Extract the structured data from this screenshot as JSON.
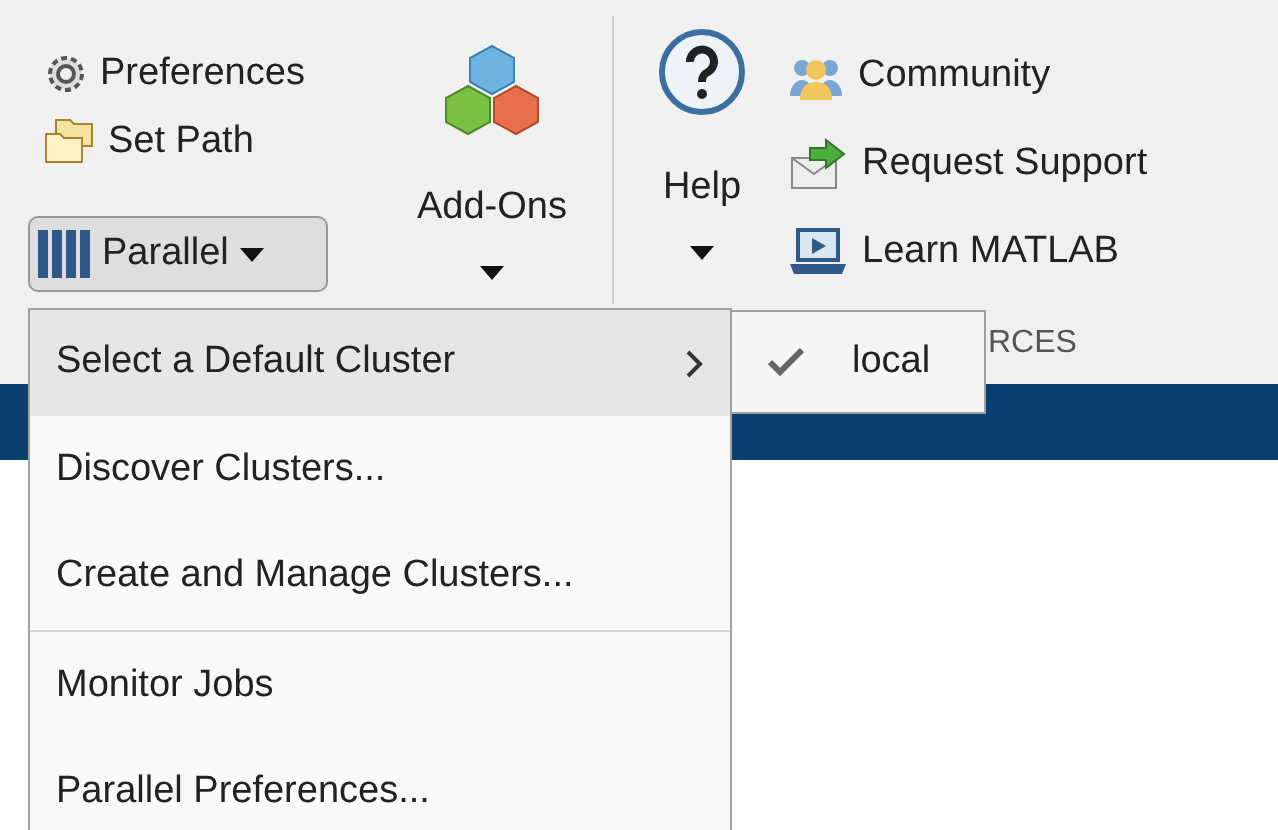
{
  "toolbar": {
    "left_items": [
      {
        "label": "Preferences"
      },
      {
        "label": "Set Path"
      }
    ],
    "parallel_button": {
      "label": "Parallel",
      "pressed": true
    },
    "add_ons": {
      "label": "Add-Ons"
    },
    "help": {
      "label": "Help"
    },
    "resources_items": [
      {
        "label": "Community"
      },
      {
        "label": "Request Support"
      },
      {
        "label": "Learn MATLAB"
      }
    ],
    "section_label": "RCES"
  },
  "menu": {
    "items": [
      {
        "kind": "submenu",
        "label": "Select a Default Cluster",
        "selected": true
      },
      {
        "kind": "item",
        "label": "Discover Clusters...",
        "selected": false
      },
      {
        "kind": "item",
        "label": "Create and Manage Clusters...",
        "selected": false
      },
      {
        "kind": "separator"
      },
      {
        "kind": "item",
        "label": "Monitor Jobs",
        "selected": false
      },
      {
        "kind": "item",
        "label": "Parallel Preferences...",
        "selected": false
      }
    ]
  },
  "submenu": {
    "items": [
      {
        "label": "local",
        "checked": true
      }
    ]
  }
}
